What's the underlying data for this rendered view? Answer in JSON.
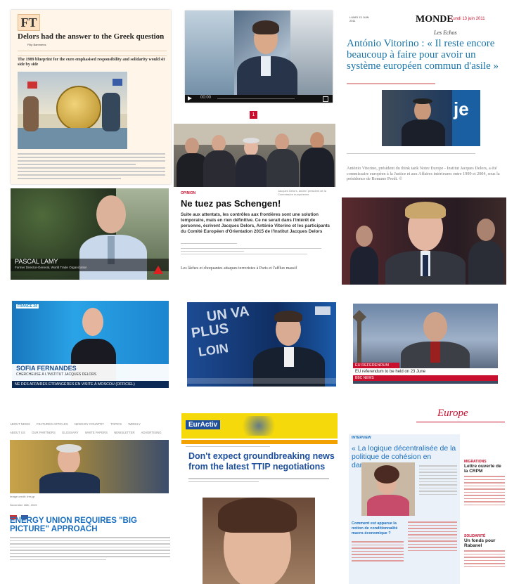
{
  "ft": {
    "logo": "FT",
    "headline": "Delors had the answer to the Greek question",
    "byline": "Filip Bammens",
    "standfirst": "The 1989 blueprint for the euro emphasised responsibility and solidarity would sit side by side"
  },
  "video1": {
    "time": "00:00"
  },
  "monde": {
    "masthead": "MONDE",
    "date": "Lundi 13 juin 2011",
    "section": "Les Echos",
    "headline": "António Vitorino : « Il reste encore beaucoup à faire pour avoir un système européen commun d'asile »",
    "caption": "António Vitorino, président du think tank Notre Europe - Institut Jacques Delors, a été commissaire européen à la Justice et aux Affaires intérieures entre 1999 et 2004, sous la présidence de Romano Prodi. ©"
  },
  "opinion": {
    "badge": "1",
    "label": "OPINION",
    "headline": "Ne tuez pas Schengen!",
    "lede": "Suite aux attentats, les contrôles aux frontières sont une solution temporaire, mais en rien définitive. Ce ne serait dans l'intérêt de personne, écrivent Jacques Delors, António Vitorino et les participants du Comité Européen d'Orientation 2015 de l'Institut Jacques Delors",
    "last_line": "Les lâches et choquantes attaques terroristes à Paris et l'afflux massif"
  },
  "lamy": {
    "name": "PASCAL LAMY",
    "title": "Former Director-General, World Trade Organization"
  },
  "france24": {
    "channel": "FRANCE 24",
    "name": "SOFIA FERNANDES",
    "role": "CHERCHEUSE À L'INSTITUT JACQUES DELORS",
    "ticker": "NE DES AFFAIRES ÉTRANGÈRES EN VISITE À MOSCOU (OFFICIEL)"
  },
  "unvaplusloin": {
    "word1": "UN VA",
    "word2": "PLUS",
    "word3": "LOIN"
  },
  "bbc": {
    "ticker1": "EU REFERENDUM",
    "ticker2": "EU referendum to be held on 23 June",
    "ticker3": "BBC NEWS"
  },
  "energy": {
    "nav": [
      "ABOUT NEWS",
      "FEATURED ARTICLES",
      "NEWS BY COUNTRY",
      "TOPICS",
      "WEEKLY",
      "ABOUT US",
      "OUR PARTNERS",
      "GLOSSARY",
      "WHITE PAPERS",
      "NEWSLETTER",
      "ADVERTISING"
    ],
    "caption": "Image credit: tres.gr",
    "date": "November 18th, 2015",
    "headline": "ENERGY UNION REQUIRES \"BIG PICTURE\" APPROACH"
  },
  "euractiv": {
    "logo": "EurActiv",
    "headline": "Don't expect groundbreaking news from the latest TTIP negotiations"
  },
  "europe": {
    "masthead": "Europe",
    "interview": "INTERVIEW",
    "headline": "« La logique décentralisée de la politique de cohésion en danger»",
    "question": "Comment est apparue la notion de conditionnalité macro-économique ?",
    "side1_label": "MIGRATIONS",
    "side1_title": "Lettre ouverte de la CRPM",
    "side2_label": "SOLIDARITÉ",
    "side2_title": "Un fonds pour Rabanel"
  },
  "colors": {
    "ft_bg": "#fce9d4",
    "red": "#c8102e",
    "euractiv_yellow": "#f5d90a",
    "euractiv_blue": "#1d4f9c",
    "energy_blue": "#1a6fc0",
    "france24_blue": "#1e90d6"
  }
}
